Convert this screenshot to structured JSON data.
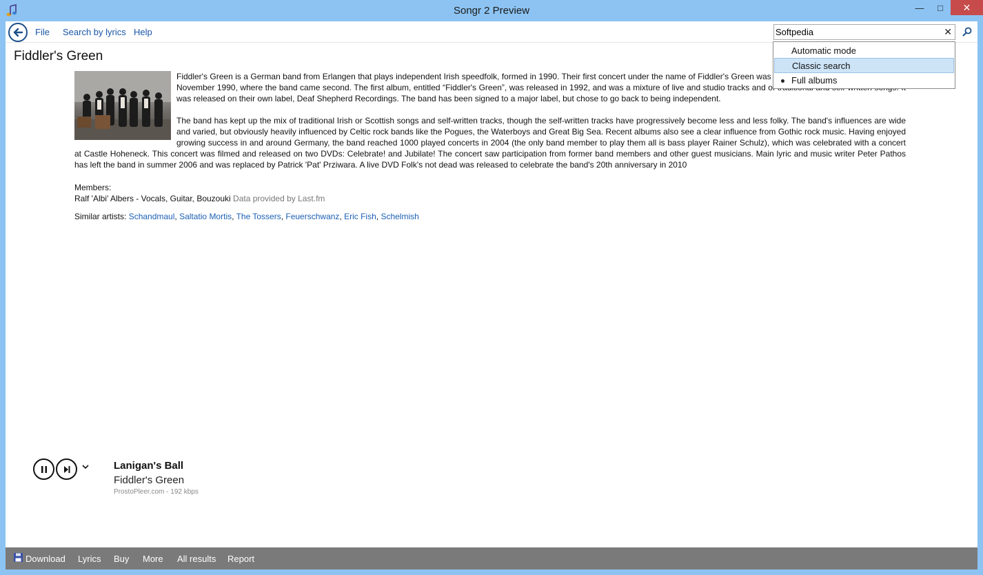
{
  "window": {
    "title": "Songr 2 Preview",
    "minimize": "—",
    "maximize": "□",
    "close": "✕"
  },
  "menu": {
    "file": "File",
    "search_by_lyrics": "Search by lyrics",
    "help": "Help"
  },
  "search": {
    "value": "Softpedia",
    "clear": "✕"
  },
  "search_modes": {
    "items": [
      "Automatic mode",
      "Classic search",
      "Full albums"
    ],
    "highlighted": "Classic search",
    "checked": "Full albums"
  },
  "artist": {
    "name": "Fiddler's Green",
    "bio_paragraph_1": "Fiddler's Green is a German band from Erlangen that plays independent Irish speedfolk, formed in 1990. Their first concert under the name of Fiddler's Green was at the Nuremberg Pop Newcomer in November 1990, where the band came second. The first album, entitled “Fiddler's Green”, was released in 1992, and was a mixture of live and studio tracks and of traditional and self-written songs. It was released on their own label, Deaf Shepherd Recordings. The band has been signed to a major label, but chose to go back to being independent.",
    "bio_paragraph_2": "The band has kept up the mix of traditional Irish or Scottish songs and self-written tracks, though the self-written tracks have progressively become less and less folky. The band's influences are wide and varied, but obviously heavily influenced by Celtic rock bands like the Pogues, the Waterboys and Great Big Sea. Recent albums also see a clear influence from Gothic rock music. Having enjoyed growing success in and around Germany, the band reached 1000 played concerts in 2004 (the only band member to play them all is bass player Rainer Schulz), which was celebrated with a concert at Castle Hoheneck. This concert was filmed and released on two DVDs: Celebrate! and Jubilate! The concert saw participation from former band members and other guest musicians. Main lyric and music writer Peter Pathos has left the band in summer 2006 and was replaced by Patrick 'Pat' Prziwara. A live DVD Folk's not dead was released to celebrate the band's 20th anniversary in 2010",
    "members_label": "Members:",
    "member_1": "Ralf 'Albi' Albers - Vocals, Guitar, Bouzouki",
    "data_provider": "Data provided by Last.fm",
    "similar_label": "Similar artists:",
    "similar_artists": [
      "Schandmaul",
      "Saltatio Mortis",
      "The Tossers",
      "Feuerschwanz",
      "Eric Fish",
      "Schelmish"
    ]
  },
  "player": {
    "track_title": "Lanigan's Ball",
    "track_artist": "Fiddler's Green",
    "source": "ProstoPleer.com - 192 kbps"
  },
  "bottom_bar": {
    "download": "Download",
    "lyrics": "Lyrics",
    "buy": "Buy",
    "more": "More",
    "all_results": "All results",
    "report": "Report"
  },
  "colors": {
    "titlebar": "#8cc3f2",
    "link": "#1a5fb4",
    "close": "#c74b4b",
    "bottom_bar": "#7a7a7a",
    "highlight": "#cde4f7"
  }
}
